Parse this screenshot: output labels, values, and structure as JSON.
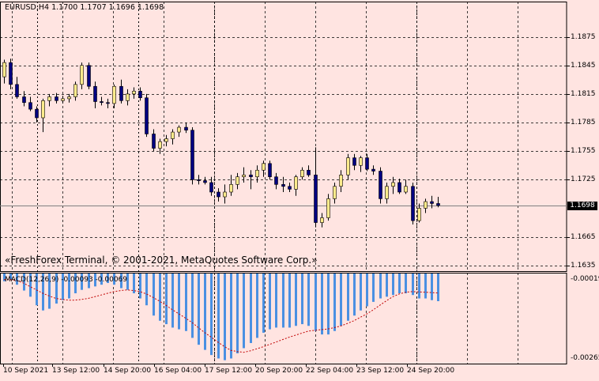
{
  "header": {
    "symbol": "EURUSD,H4",
    "ohlc": "1.1700 1.1707 1.1696 1.1698"
  },
  "copyright": "«FreshForex Terminal, © 2001-2021, MetaQuotes Software Corp.»",
  "macd": {
    "label": "MACD(12,26,9) -0.00093 -0.00069",
    "scale_top": "-0.00019",
    "scale_bottom": "-0.00265"
  },
  "current_price": "1.1698",
  "colors": {
    "background": "#FFE4E1",
    "bull_candle": "#FFEB8C",
    "bear_candle": "#000080",
    "macd_hist": "#4A90E2",
    "signal": "#C00000",
    "grid": "#000000"
  },
  "chart_data": {
    "type": "candlestick",
    "price_axis_ticks": [
      "1.1875",
      "1.1845",
      "1.1815",
      "1.1785",
      "1.1755",
      "1.1725",
      "1.1665",
      "1.1635"
    ],
    "price_range": [
      1.1629,
      1.1912
    ],
    "time_axis_ticks": [
      "10 Sep 2021",
      "13 Sep 12:00",
      "14 Sep 20:00",
      "16 Sep 04:00",
      "17 Sep 12:00",
      "20 Sep 20:00",
      "22 Sep 04:00",
      "23 Sep 12:00",
      "24 Sep 20:00"
    ],
    "candles": [
      [
        1.1833,
        1.1851,
        1.1826,
        1.1848
      ],
      [
        1.1848,
        1.1852,
        1.182,
        1.1825
      ],
      [
        1.1825,
        1.1833,
        1.181,
        1.1812
      ],
      [
        1.1812,
        1.1818,
        1.1802,
        1.1806
      ],
      [
        1.1806,
        1.1812,
        1.1797,
        1.1799
      ],
      [
        1.1799,
        1.1802,
        1.1785,
        1.179
      ],
      [
        1.179,
        1.181,
        1.1775,
        1.1808
      ],
      [
        1.1808,
        1.1815,
        1.1802,
        1.1812
      ],
      [
        1.1812,
        1.1816,
        1.1805,
        1.1808
      ],
      [
        1.1808,
        1.1813,
        1.1805,
        1.181
      ],
      [
        1.181,
        1.1815,
        1.1806,
        1.1812
      ],
      [
        1.1812,
        1.1828,
        1.1808,
        1.1825
      ],
      [
        1.1825,
        1.1848,
        1.182,
        1.1845
      ],
      [
        1.1845,
        1.1848,
        1.182,
        1.1823
      ],
      [
        1.1823,
        1.1828,
        1.18,
        1.1807
      ],
      [
        1.1807,
        1.1812,
        1.1803,
        1.1806
      ],
      [
        1.1806,
        1.181,
        1.18,
        1.1805
      ],
      [
        1.1805,
        1.1825,
        1.18,
        1.1823
      ],
      [
        1.1823,
        1.183,
        1.1805,
        1.1808
      ],
      [
        1.1808,
        1.182,
        1.1803,
        1.1815
      ],
      [
        1.1815,
        1.1822,
        1.181,
        1.1818
      ],
      [
        1.1818,
        1.1822,
        1.1808,
        1.1811
      ],
      [
        1.1811,
        1.1815,
        1.177,
        1.1773
      ],
      [
        1.1773,
        1.1778,
        1.1755,
        1.1758
      ],
      [
        1.1758,
        1.1768,
        1.1752,
        1.1765
      ],
      [
        1.1765,
        1.1772,
        1.176,
        1.1768
      ],
      [
        1.1768,
        1.1778,
        1.1762,
        1.1775
      ],
      [
        1.1775,
        1.1782,
        1.177,
        1.178
      ],
      [
        1.178,
        1.1785,
        1.1774,
        1.1777
      ],
      [
        1.1777,
        1.178,
        1.172,
        1.1725
      ],
      [
        1.1725,
        1.173,
        1.172,
        1.1724
      ],
      [
        1.1724,
        1.1728,
        1.172,
        1.1722
      ],
      [
        1.1722,
        1.1728,
        1.1708,
        1.1712
      ],
      [
        1.1712,
        1.1716,
        1.1702,
        1.1707
      ],
      [
        1.1707,
        1.172,
        1.17,
        1.1712
      ],
      [
        1.1712,
        1.173,
        1.1708,
        1.172
      ],
      [
        1.172,
        1.1732,
        1.1715,
        1.1728
      ],
      [
        1.1728,
        1.1738,
        1.1722,
        1.173
      ],
      [
        1.173,
        1.1735,
        1.1715,
        1.1728
      ],
      [
        1.1728,
        1.174,
        1.1722,
        1.1735
      ],
      [
        1.1735,
        1.1745,
        1.1728,
        1.1742
      ],
      [
        1.1742,
        1.1745,
        1.1725,
        1.1728
      ],
      [
        1.1728,
        1.1732,
        1.1715,
        1.172
      ],
      [
        1.172,
        1.1728,
        1.1712,
        1.1718
      ],
      [
        1.1718,
        1.1722,
        1.1712,
        1.1715
      ],
      [
        1.1715,
        1.173,
        1.1708,
        1.1728
      ],
      [
        1.1728,
        1.1738,
        1.1725,
        1.1735
      ],
      [
        1.1735,
        1.174,
        1.1728,
        1.173
      ],
      [
        1.173,
        1.1759,
        1.1675,
        1.168
      ],
      [
        1.168,
        1.169,
        1.1675,
        1.1685
      ],
      [
        1.1685,
        1.171,
        1.1682,
        1.1705
      ],
      [
        1.1705,
        1.1722,
        1.17,
        1.1718
      ],
      [
        1.1718,
        1.1735,
        1.1712,
        1.173
      ],
      [
        1.173,
        1.1752,
        1.1725,
        1.1748
      ],
      [
        1.1748,
        1.1752,
        1.1735,
        1.174
      ],
      [
        1.174,
        1.175,
        1.1733,
        1.1748
      ],
      [
        1.1748,
        1.1752,
        1.1734,
        1.1736
      ],
      [
        1.1736,
        1.174,
        1.173,
        1.1734
      ],
      [
        1.1734,
        1.1738,
        1.17,
        1.1705
      ],
      [
        1.1705,
        1.1722,
        1.17,
        1.1718
      ],
      [
        1.1718,
        1.1728,
        1.171,
        1.1722
      ],
      [
        1.1722,
        1.1726,
        1.171,
        1.1712
      ],
      [
        1.1712,
        1.1725,
        1.171,
        1.1718
      ],
      [
        1.1718,
        1.1722,
        1.1678,
        1.1682
      ],
      [
        1.1682,
        1.17,
        1.168,
        1.1695
      ],
      [
        1.1695,
        1.1705,
        1.169,
        1.1702
      ],
      [
        1.1702,
        1.1708,
        1.1695,
        1.17
      ],
      [
        1.17,
        1.1707,
        1.1696,
        1.1698
      ]
    ],
    "macd_histogram": [
      -0.00035,
      -0.0003,
      -0.00045,
      -0.00062,
      -0.0008,
      -0.00105,
      -0.0012,
      -0.00115,
      -0.001,
      -0.0009,
      -0.00085,
      -0.0007,
      -0.0006,
      -0.00055,
      -0.0005,
      -0.00045,
      -0.0004,
      -0.00045,
      -0.00055,
      -0.0006,
      -0.0007,
      -0.00085,
      -0.00105,
      -0.00135,
      -0.0015,
      -0.0016,
      -0.0017,
      -0.00175,
      -0.0018,
      -0.002,
      -0.0022,
      -0.00235,
      -0.0025,
      -0.0026,
      -0.00265,
      -0.0026,
      -0.00245,
      -0.0023,
      -0.00215,
      -0.002,
      -0.00185,
      -0.00175,
      -0.0017,
      -0.0017,
      -0.0017,
      -0.00165,
      -0.0016,
      -0.00165,
      -0.0018,
      -0.0019,
      -0.0019,
      -0.0018,
      -0.00165,
      -0.0015,
      -0.00135,
      -0.0012,
      -0.00108,
      -0.00095,
      -0.00085,
      -0.0008,
      -0.00075,
      -0.0007,
      -0.0007,
      -0.00075,
      -0.00085,
      -0.00085,
      -0.0009,
      -0.00093
    ],
    "macd_signal": [
      -0.0003,
      -0.0003,
      -0.00033,
      -0.0004,
      -0.0005,
      -0.0006,
      -0.0007,
      -0.00078,
      -0.00085,
      -0.00088,
      -0.0009,
      -0.0009,
      -0.00088,
      -0.00085,
      -0.0008,
      -0.00075,
      -0.0007,
      -0.00065,
      -0.00062,
      -0.0006,
      -0.00062,
      -0.00065,
      -0.00072,
      -0.00082,
      -0.00093,
      -0.00105,
      -0.00118,
      -0.0013,
      -0.00142,
      -0.00155,
      -0.0017,
      -0.00185,
      -0.00198,
      -0.00212,
      -0.00225,
      -0.00236,
      -0.0024,
      -0.00242,
      -0.00238,
      -0.00232,
      -0.00226,
      -0.00219,
      -0.00212,
      -0.00205,
      -0.00198,
      -0.00192,
      -0.00186,
      -0.0018,
      -0.00178,
      -0.00176,
      -0.00174,
      -0.0017,
      -0.00165,
      -0.00158,
      -0.0015,
      -0.0014,
      -0.0013,
      -0.00118,
      -0.00105,
      -0.00092,
      -0.0008,
      -0.00072,
      -0.00067,
      -0.00065,
      -0.00066,
      -0.00067,
      -0.00068,
      -0.00069
    ],
    "macd_range": [
      -0.00275,
      -0.0001
    ]
  }
}
